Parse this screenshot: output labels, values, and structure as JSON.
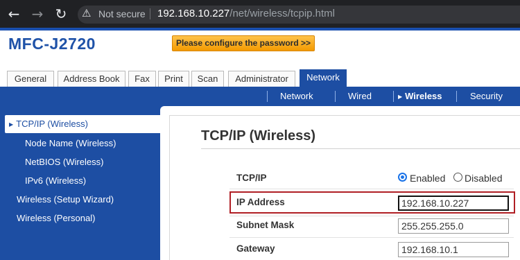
{
  "browser": {
    "back_icon": "arrow-left-icon",
    "forward_icon": "arrow-right-icon",
    "reload_icon": "reload-icon",
    "security_icon": "warning-triangle-icon",
    "security_text": "Not secure",
    "url_host": "192.168.10.227",
    "url_path": "/net/wireless/tcpip.html"
  },
  "header": {
    "model": "MFC-J2720",
    "config_button": "Please configure the password >>"
  },
  "tabs": [
    {
      "label": "General"
    },
    {
      "label": "Address Book"
    },
    {
      "label": "Fax"
    },
    {
      "label": "Print"
    },
    {
      "label": "Scan"
    },
    {
      "label": "Administrator"
    },
    {
      "label": "Network",
      "active": true
    }
  ],
  "subnav": [
    {
      "label": "Network"
    },
    {
      "label": "Wired"
    },
    {
      "label": "Wireless",
      "selected": true
    },
    {
      "label": "Security"
    }
  ],
  "sidebar": [
    {
      "label": "TCP/IP (Wireless)",
      "selected": true
    },
    {
      "label": "Node Name (Wireless)"
    },
    {
      "label": "NetBIOS (Wireless)"
    },
    {
      "label": "IPv6 (Wireless)"
    },
    {
      "label": "Wireless (Setup Wizard)"
    },
    {
      "label": "Wireless (Personal)"
    }
  ],
  "content": {
    "title": "TCP/IP (Wireless)",
    "tcpip_label": "TCP/IP",
    "enabled_label": "Enabled",
    "disabled_label": "Disabled",
    "tcpip_state": "Enabled",
    "ip_label": "IP Address",
    "ip_value": "192.168.10.227",
    "subnet_label": "Subnet Mask",
    "subnet_value": "255.255.255.0",
    "gateway_label": "Gateway",
    "gateway_value": "192.168.10.1"
  },
  "colors": {
    "brand_blue": "#1d4ea3",
    "highlight_red": "#b01e24",
    "config_orange": "#f39a00"
  }
}
